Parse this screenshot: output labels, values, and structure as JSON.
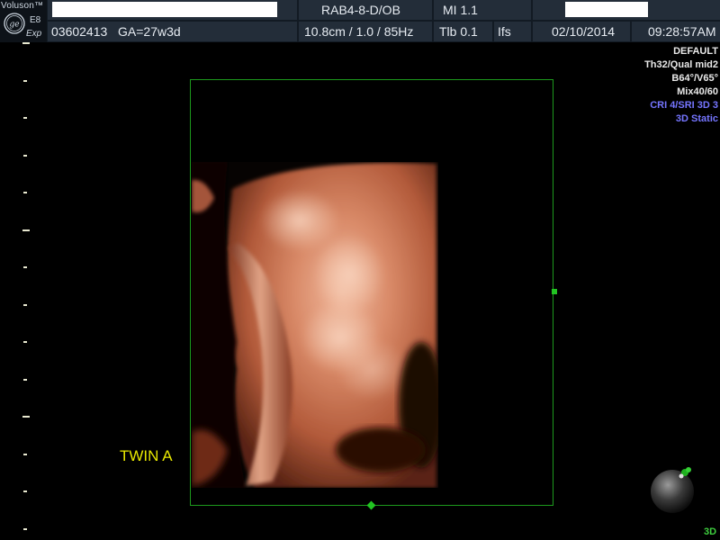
{
  "header": {
    "brand": "Voluson™",
    "model_line1": "E8",
    "model_line2": "Exp",
    "probe": "RAB4-8-D/OB",
    "mi": "MI  1.1",
    "patient_id": "03602413",
    "ga": "GA=27w3d",
    "depth_freq": "10.8cm / 1.0 / 85Hz",
    "tib": "Tlb  0.1",
    "ifs": "Ifs",
    "date": "02/10/2014",
    "time": "09:28:57AM"
  },
  "info_panel": {
    "preset": "DEFAULT",
    "quality": "Th32/Qual mid2",
    "angles": "B64°/V65°",
    "mix": "Mix40/60",
    "cri": "CRI 4/SRI 3D 3",
    "mode": "3D Static"
  },
  "annotations": {
    "twin_label": "TWIN A",
    "mode_3d": "3D"
  },
  "colors": {
    "roi_border": "#1d9a1d",
    "twin_label": "#e8e800",
    "info_highlight": "#7575ff",
    "tissue": "#c87a5a"
  },
  "icons": {
    "logo": "ge-logo-icon",
    "orientation": "orientation-sphere-icon"
  }
}
